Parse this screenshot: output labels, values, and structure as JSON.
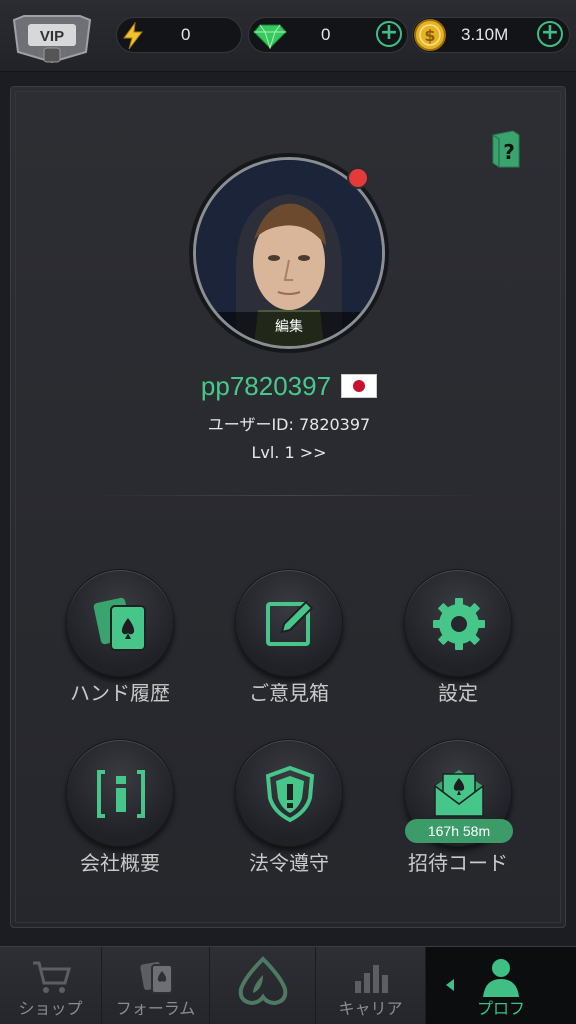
{
  "topbar": {
    "vip_badge": "VIP",
    "energy": {
      "icon": "lightning-icon",
      "value": "0"
    },
    "gems": {
      "icon": "gem-icon",
      "value": "0"
    },
    "coins": {
      "icon": "coin-icon",
      "value": "3.10M"
    },
    "add_symbol": "+"
  },
  "profile": {
    "edit_label": "編集",
    "username": "pp7820397",
    "flag": "japan-flag",
    "user_id": "ユーザーID: 7820397",
    "level": "Lvl. 1 >>"
  },
  "menu": [
    {
      "label": "ハンド履歴",
      "icon": "cards-icon"
    },
    {
      "label": "ご意見箱",
      "icon": "feedback-icon"
    },
    {
      "label": "設定",
      "icon": "gear-icon"
    },
    {
      "label": "会社概要",
      "icon": "info-icon"
    },
    {
      "label": "法令遵守",
      "icon": "shield-icon"
    },
    {
      "label": "招待コード",
      "icon": "invite-icon",
      "timer": "167h 58m"
    }
  ],
  "nav": [
    {
      "label": "ショップ",
      "icon": "cart-icon"
    },
    {
      "label": "フォーラム",
      "icon": "forum-icon"
    },
    {
      "label": "",
      "icon": "spade-logo-icon"
    },
    {
      "label": "キャリア",
      "icon": "bar-chart-icon"
    },
    {
      "label": "プロフ",
      "icon": "person-icon",
      "active": true
    }
  ],
  "colors": {
    "accent": "#3fbf84",
    "username": "#48c98c",
    "notification": "#e53a3a"
  }
}
